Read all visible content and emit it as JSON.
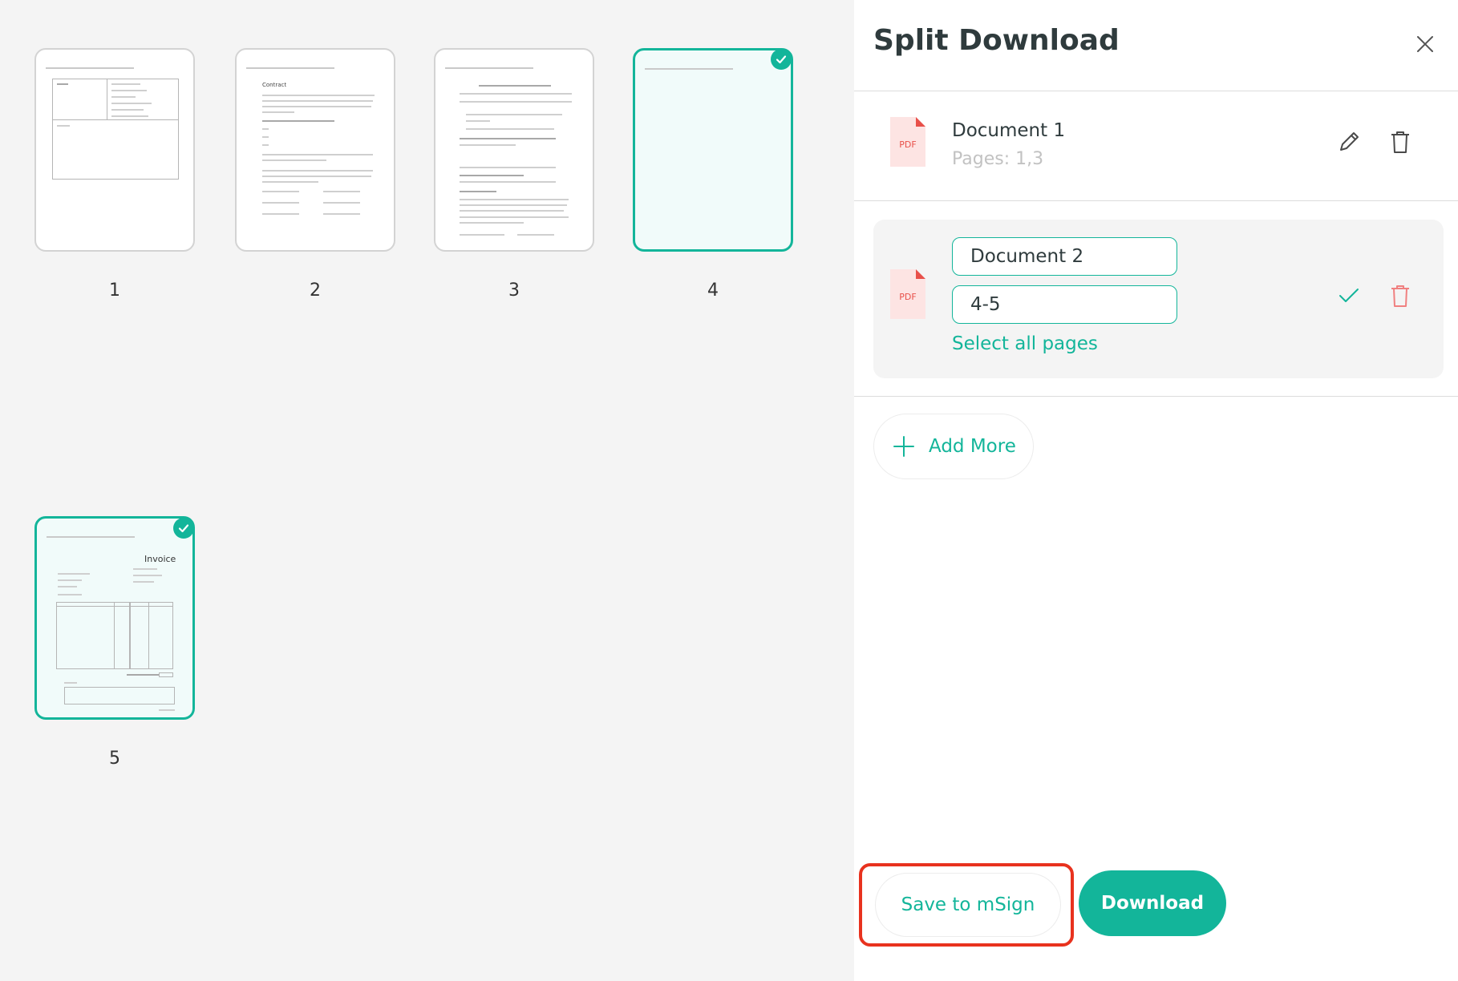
{
  "panel": {
    "title": "Split Download",
    "close_icon": "close-icon"
  },
  "pages": [
    {
      "number": "1",
      "selected": false
    },
    {
      "number": "2",
      "selected": false
    },
    {
      "number": "3",
      "selected": false
    },
    {
      "number": "4",
      "selected": true
    },
    {
      "number": "5",
      "selected": true
    }
  ],
  "thumbs": {
    "contract_title": "Contract",
    "invoice_title": "Invoice"
  },
  "documents": [
    {
      "name": "Document 1",
      "pages": "Pages: 1,3",
      "badge": "PDF"
    },
    {
      "name": "Document 2",
      "range": "4-5",
      "badge": "PDF",
      "select_all": "Select all pages"
    }
  ],
  "actions": {
    "add_more": "Add More",
    "save": "Save to mSign",
    "download": "Download"
  },
  "colors": {
    "accent": "#13b59a",
    "pdf_red": "#e8504a",
    "highlight": "#e8321e"
  }
}
